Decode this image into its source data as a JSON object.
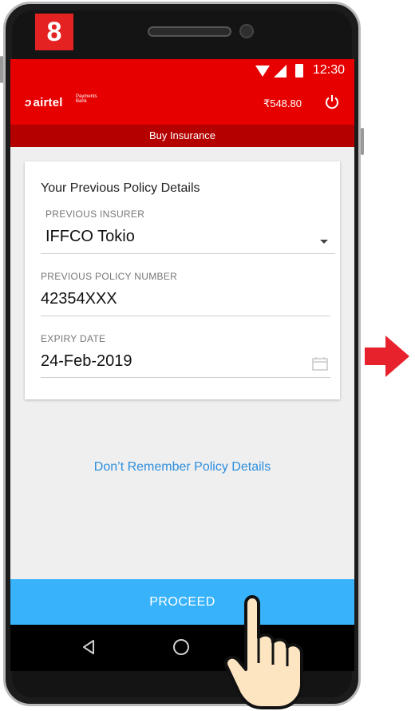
{
  "step": "8",
  "status_bar": {
    "time": "12:30"
  },
  "app_bar": {
    "logo_text": "airtel",
    "logo_sub": "Payments Bank",
    "balance": "₹548.80"
  },
  "sub_header": "Buy Insurance",
  "card": {
    "title": "Your Previous Policy Details",
    "insurer_label": "PREVIOUS INSURER",
    "insurer_value": "IFFCO Tokio",
    "policy_label": "PREVIOUS POLICY NUMBER",
    "policy_value": "42354XXX",
    "expiry_label": "EXPIRY DATE",
    "expiry_value": "24-Feb-2019"
  },
  "link_text": "Don’t Remember Policy Details",
  "proceed_label": "PROCEED",
  "colors": {
    "brand_red": "#e60000",
    "proceed_blue": "#38b3fb",
    "link_blue": "#2b8ede"
  },
  "icons": [
    "wifi-icon",
    "signal-icon",
    "battery-icon",
    "power-icon",
    "dropdown-icon",
    "calendar-icon",
    "back-icon",
    "home-icon",
    "arrow-right-icon",
    "pointing-hand-icon"
  ]
}
